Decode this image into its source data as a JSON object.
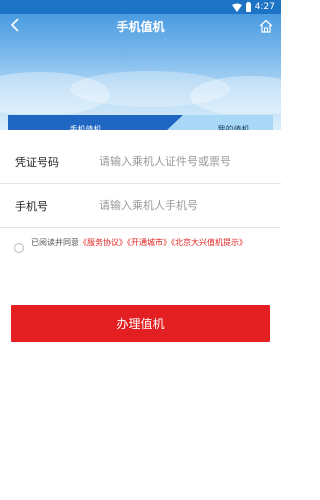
{
  "status_bar": {
    "time": "4:27"
  },
  "header": {
    "title": "手机值机",
    "back_icon": "back-arrow-icon",
    "home_icon": "home-icon"
  },
  "tabs": [
    {
      "label": "手机值机",
      "active": true
    },
    {
      "label": "我的值机",
      "active": false
    }
  ],
  "form": {
    "credential": {
      "label": "凭证号码",
      "placeholder": "请输入乘机人证件号或票号"
    },
    "phone": {
      "label": "手机号",
      "placeholder": "请输入乘机人手机号"
    }
  },
  "agreement": {
    "prefix": "已阅读并同意",
    "links": [
      "《服务协议》",
      "《开通城市》",
      "《北京大兴值机提示》"
    ],
    "checked": false
  },
  "submit": {
    "label": "办理值机"
  },
  "colors": {
    "primary_blue": "#1f67c3",
    "tab_light": "#a9d8f7",
    "submit_red": "#e41f22",
    "link_red": "#e0201e"
  }
}
